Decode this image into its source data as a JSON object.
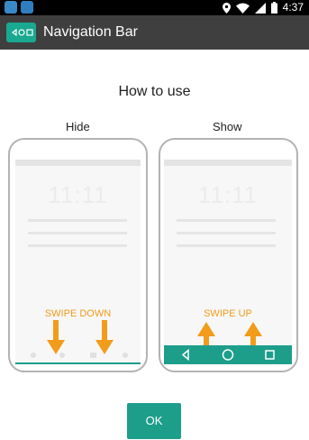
{
  "status_bar": {
    "time": "4:37",
    "icons": [
      "app-icon",
      "app-icon",
      "location-icon",
      "wifi-icon",
      "signal-icon",
      "battery-icon"
    ]
  },
  "app_bar": {
    "title": "Navigation Bar",
    "icon": "nav-bar-icon"
  },
  "dialog": {
    "heading": "How to use",
    "hide": {
      "caption": "Hide",
      "clock": "11:11",
      "swipe_text": "SWIPE DOWN"
    },
    "show": {
      "caption": "Show",
      "clock": "11:11",
      "swipe_text": "SWIPE UP"
    },
    "ok_label": "OK"
  },
  "colors": {
    "accent": "#1d9e8b",
    "swipe": "#f29c1c",
    "titlebar": "#3f3f3f"
  }
}
